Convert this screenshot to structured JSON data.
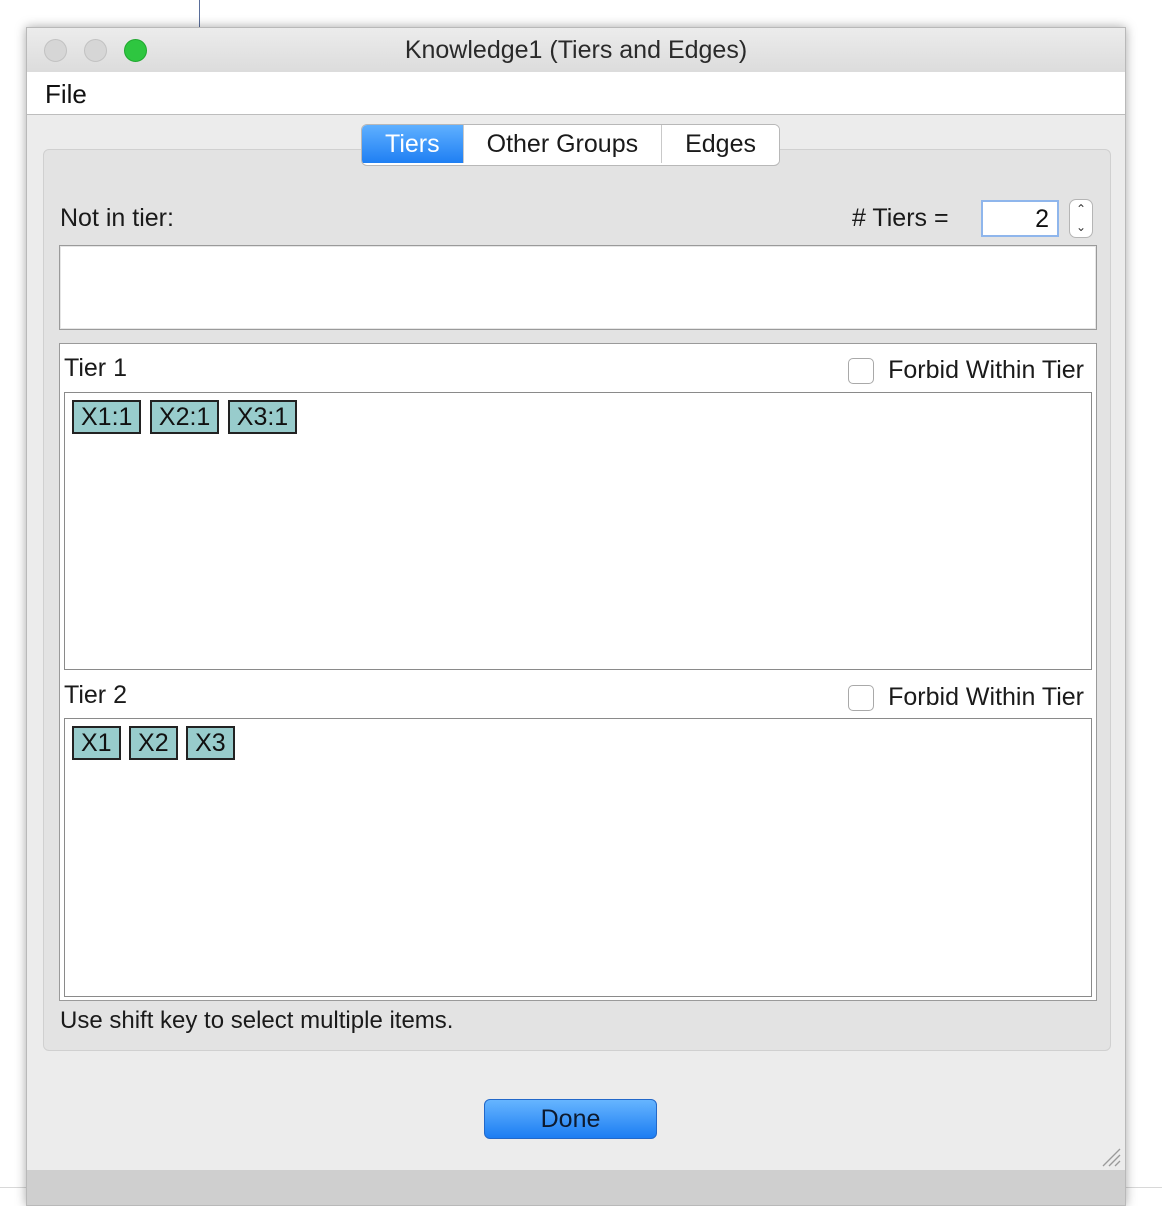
{
  "window": {
    "title": "Knowledge1 (Tiers and Edges)"
  },
  "menu": {
    "file": "File"
  },
  "tabs": [
    {
      "label": "Tiers",
      "active": true
    },
    {
      "label": "Other Groups",
      "active": false
    },
    {
      "label": "Edges",
      "active": false
    }
  ],
  "tiers_panel": {
    "not_in_tier_label": "Not in tier:",
    "num_tiers_label": "# Tiers =",
    "num_tiers_value": "2",
    "tiers": [
      {
        "label": "Tier 1",
        "forbid_label": "Forbid Within Tier",
        "forbid_checked": false,
        "items": [
          "X1:1",
          "X2:1",
          "X3:1"
        ]
      },
      {
        "label": "Tier 2",
        "forbid_label": "Forbid Within Tier",
        "forbid_checked": false,
        "items": [
          "X1",
          "X2",
          "X3"
        ]
      }
    ],
    "hint": "Use shift key to select multiple items."
  },
  "done_label": "Done",
  "colors": {
    "accent": "#1f7ff3",
    "chip_fill": "#98cccc",
    "zoom_button": "#2ec640"
  }
}
